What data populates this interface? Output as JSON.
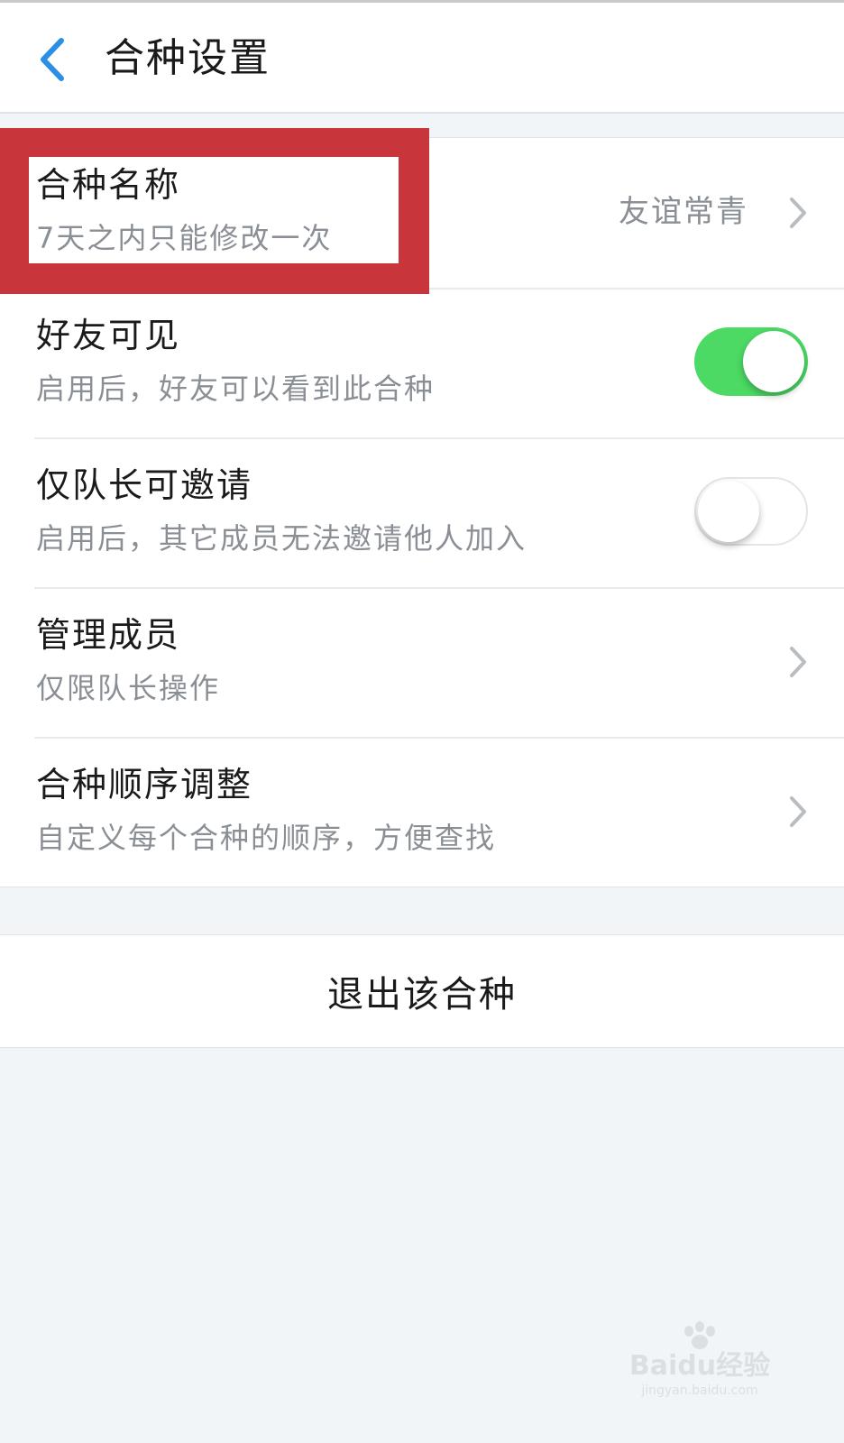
{
  "header": {
    "title": "合种设置",
    "back_icon": "chevron-left-icon"
  },
  "colors": {
    "accent": "#2b8fe3",
    "toggle_on": "#4cd964",
    "highlight": "#c8363b",
    "subtext": "#8a8f95",
    "background": "#f2f5f8"
  },
  "settings": {
    "name": {
      "title": "合种名称",
      "subtitle": "7天之内只能修改一次",
      "value": "友谊常青"
    },
    "friends_visible": {
      "title": "好友可见",
      "subtitle": "启用后，好友可以看到此合种",
      "enabled": true
    },
    "leader_invite_only": {
      "title": "仅队长可邀请",
      "subtitle": "启用后，其它成员无法邀请他人加入",
      "enabled": false
    },
    "manage_members": {
      "title": "管理成员",
      "subtitle": "仅限队长操作"
    },
    "order_adjust": {
      "title": "合种顺序调整",
      "subtitle": "自定义每个合种的顺序，方便查找"
    }
  },
  "exit": {
    "label": "退出该合种"
  },
  "watermark": {
    "brand": "Baidu经验",
    "url": "jingyan.baidu.com"
  }
}
